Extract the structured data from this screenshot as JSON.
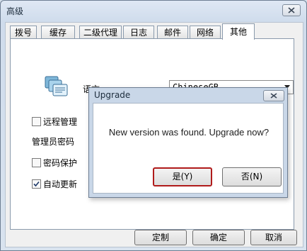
{
  "window": {
    "title": "高级"
  },
  "tabs": [
    {
      "label": "拨号"
    },
    {
      "label": "缓存"
    },
    {
      "label": "二级代理"
    },
    {
      "label": "日志"
    },
    {
      "label": "邮件"
    },
    {
      "label": "网络"
    },
    {
      "label": "其他",
      "active": true
    }
  ],
  "panel": {
    "language": {
      "label": "语言",
      "value": "ChineseGB",
      "icon": "language-icon"
    },
    "remote_mgmt": {
      "label": "远程管理",
      "checked": false
    },
    "admin_password_label": "管理员密码",
    "password_protect": {
      "label": "密码保护",
      "checked": false
    },
    "auto_update": {
      "label": "自动更新",
      "checked": true
    }
  },
  "footer": {
    "custom_label": "定制",
    "ok_label": "确定",
    "cancel_label": "取消"
  },
  "dialog": {
    "title": "Upgrade",
    "message": "New version was found. Upgrade now?",
    "yes_label": "是(Y)",
    "no_label": "否(N)"
  },
  "colors": {
    "accent_default_button": "#b01b1b"
  }
}
